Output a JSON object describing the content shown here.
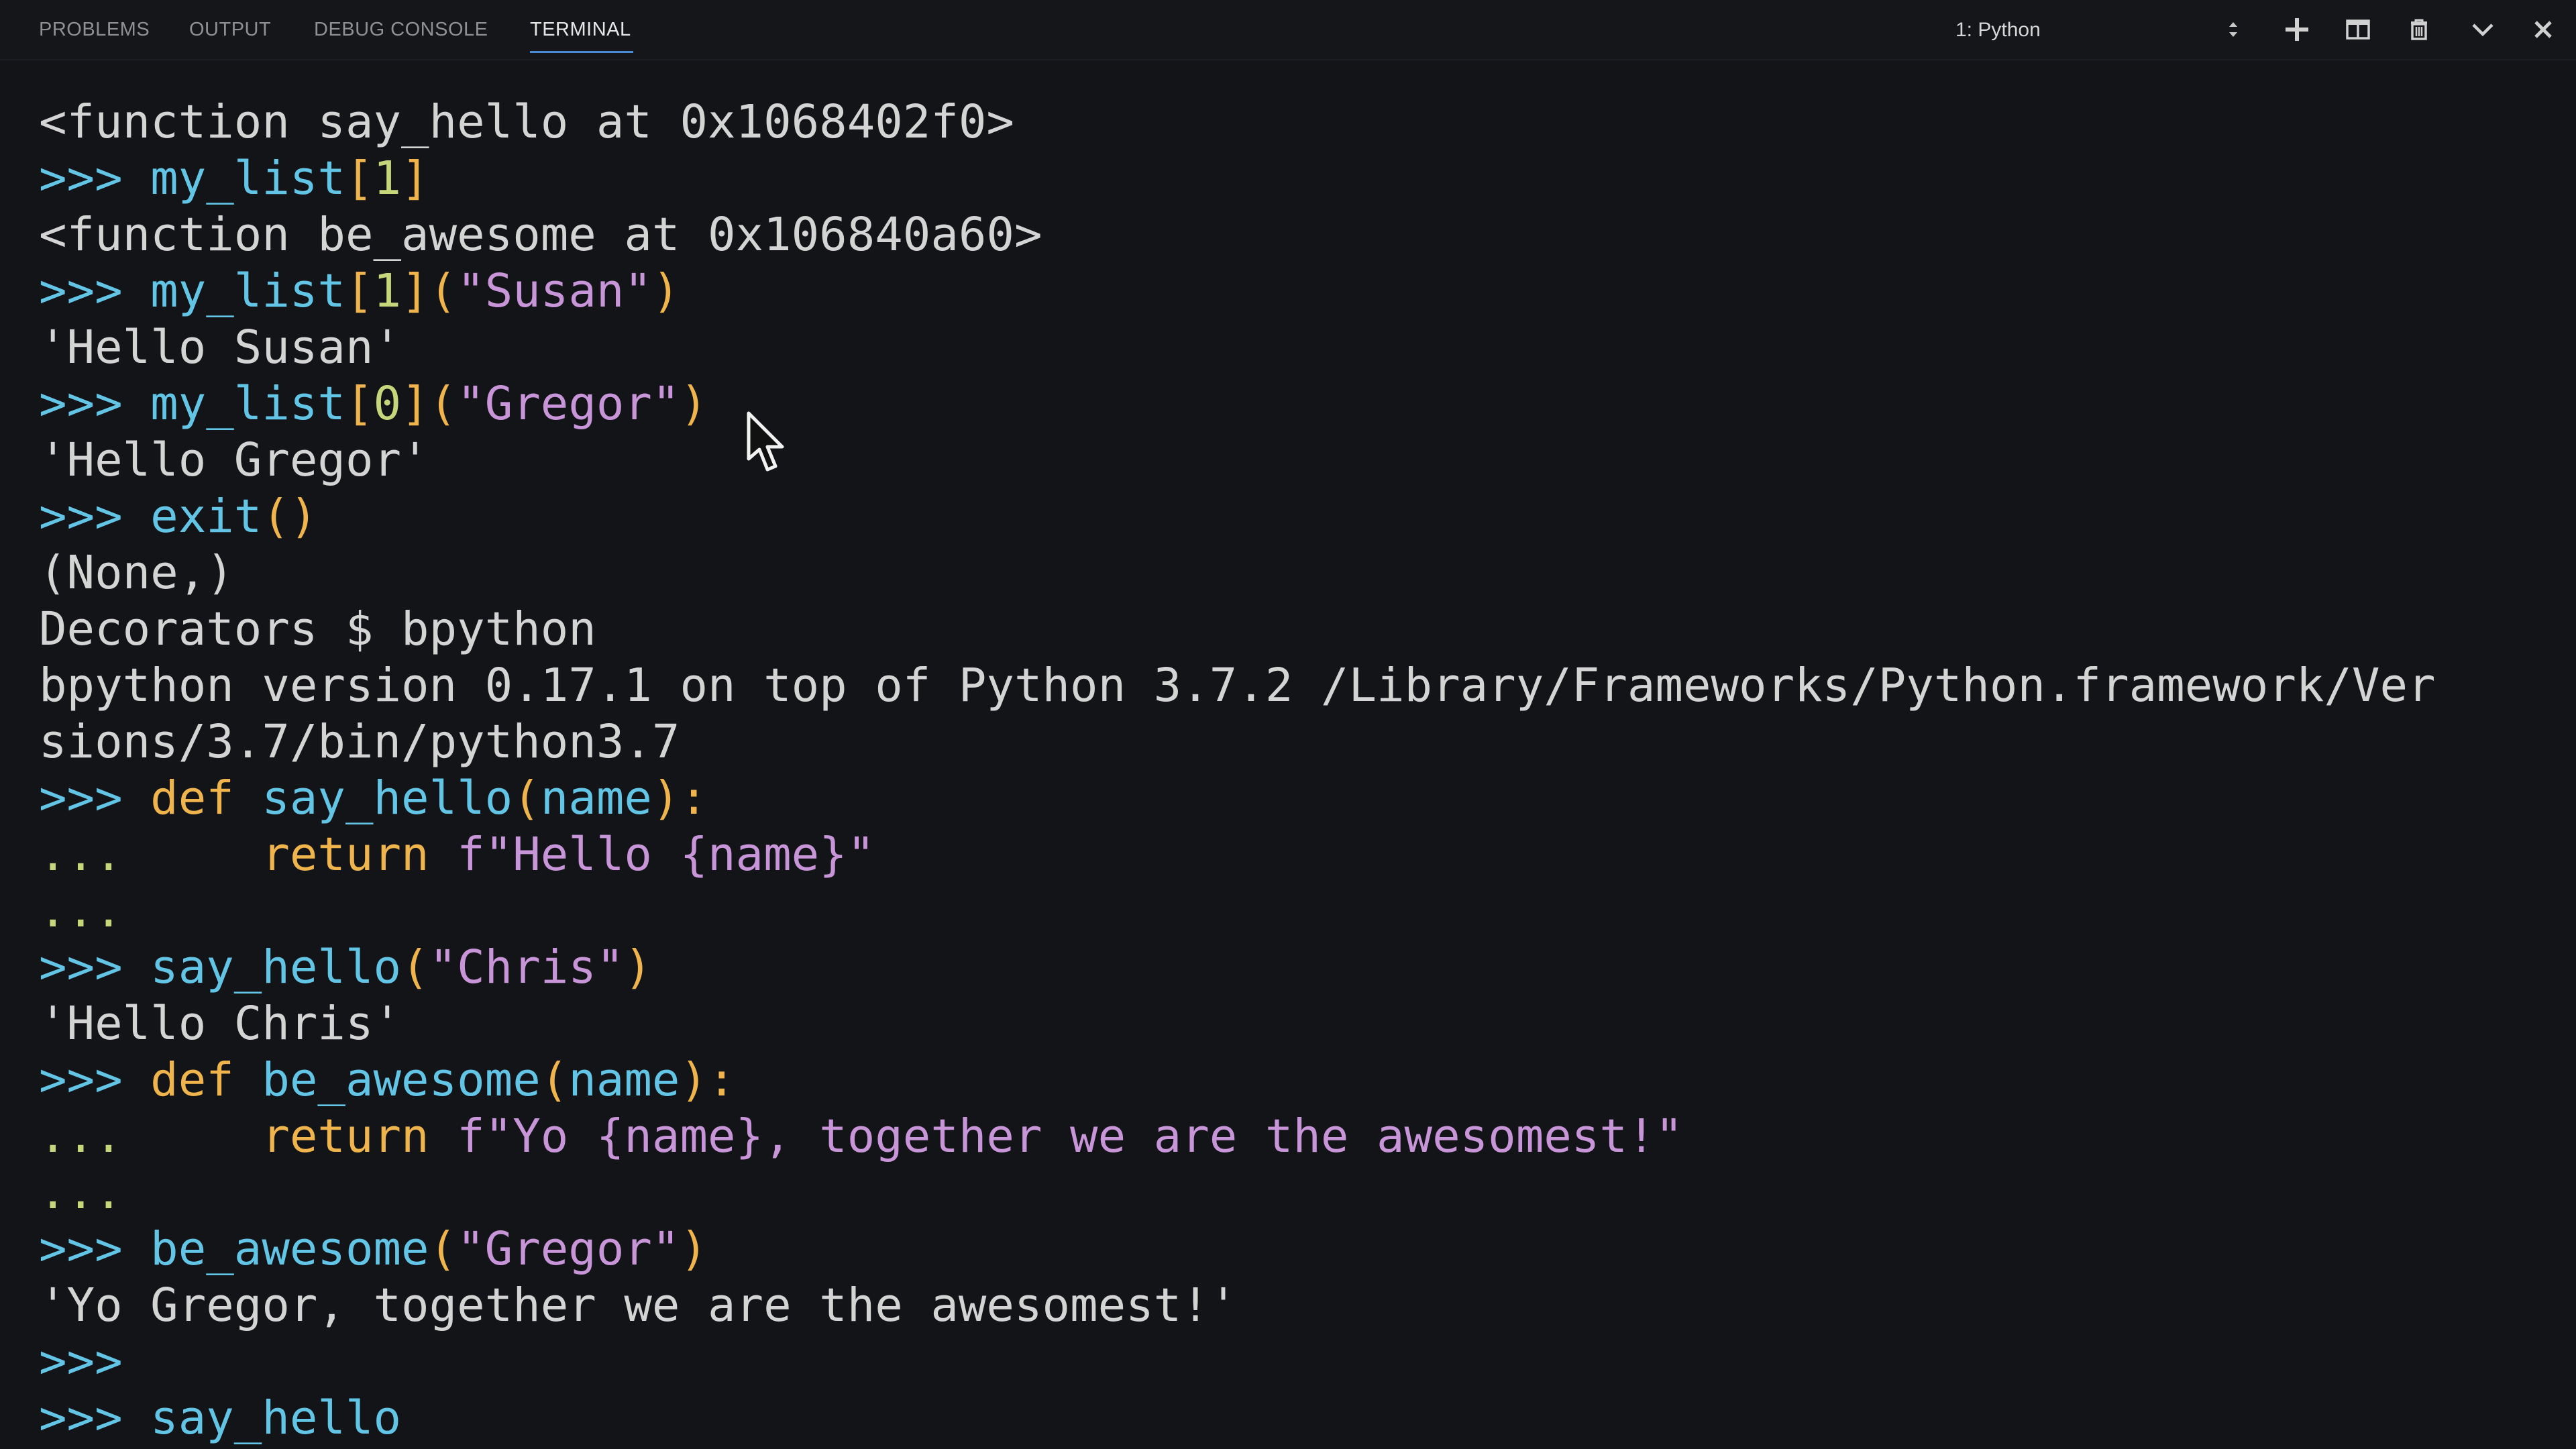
{
  "tabs": {
    "problems": "PROBLEMS",
    "output": "OUTPUT",
    "debug_console": "DEBUG CONSOLE",
    "terminal": "TERMINAL"
  },
  "terminal_select": {
    "value": "1: Python"
  },
  "toolbar_icons": [
    "plus-icon",
    "split-icon",
    "trash-icon",
    "chevron-down-icon",
    "close-icon"
  ],
  "lines": [
    {
      "kind": "out",
      "text": "<function say_hello at 0x1068402f0>"
    },
    {
      "kind": "cmd",
      "prompt": ">>> ",
      "ident": "my_list",
      "b1": "[",
      "num": "1",
      "b2": "]"
    },
    {
      "kind": "out",
      "text": "<function be_awesome at 0x106840a60>"
    },
    {
      "kind": "call",
      "prompt": ">>> ",
      "ident": "my_list",
      "b1": "[",
      "num": "1",
      "b2": "]",
      "p1": "(",
      "str": "\"Susan\"",
      "p2": ")"
    },
    {
      "kind": "out",
      "text": "'Hello Susan'"
    },
    {
      "kind": "call",
      "prompt": ">>> ",
      "ident": "my_list",
      "b1": "[",
      "num": "0",
      "b2": "]",
      "p1": "(",
      "str": "\"Gregor\"",
      "p2": ")"
    },
    {
      "kind": "out",
      "text": "'Hello Gregor'"
    },
    {
      "kind": "fn0",
      "prompt": ">>> ",
      "ident": "exit",
      "parens": "()"
    },
    {
      "kind": "out",
      "text": "(None,)"
    },
    {
      "kind": "out",
      "text": "Decorators $ bpython"
    },
    {
      "kind": "out",
      "text": "bpython version 0.17.1 on top of Python 3.7.2 /Library/Frameworks/Python.framework/Ver"
    },
    {
      "kind": "out",
      "text": "sions/3.7/bin/python3.7"
    },
    {
      "kind": "def",
      "prompt": ">>> ",
      "kw": "def ",
      "name": "say_hello",
      "p1": "(",
      "arg": "name",
      "p2": "):"
    },
    {
      "kind": "ret",
      "prompt": "...     ",
      "kw": "return ",
      "str": "f\"Hello {name}\""
    },
    {
      "kind": "cont",
      "prompt": "..."
    },
    {
      "kind": "fcall",
      "prompt": ">>> ",
      "ident": "say_hello",
      "p1": "(",
      "str": "\"Chris\"",
      "p2": ")"
    },
    {
      "kind": "out",
      "text": "'Hello Chris'"
    },
    {
      "kind": "def",
      "prompt": ">>> ",
      "kw": "def ",
      "name": "be_awesome",
      "p1": "(",
      "arg": "name",
      "p2": "):"
    },
    {
      "kind": "ret",
      "prompt": "...     ",
      "kw": "return ",
      "str": "f\"Yo {name}, together we are the awesomest!\""
    },
    {
      "kind": "cont",
      "prompt": "..."
    },
    {
      "kind": "fcall",
      "prompt": ">>> ",
      "ident": "be_awesome",
      "p1": "(",
      "str": "\"Gregor\"",
      "p2": ")"
    },
    {
      "kind": "out",
      "text": "'Yo Gregor, together we are the awesomest!'"
    },
    {
      "kind": "prompt",
      "prompt": ">>>"
    },
    {
      "kind": "ident",
      "prompt": ">>> ",
      "ident": "say_hello"
    }
  ]
}
